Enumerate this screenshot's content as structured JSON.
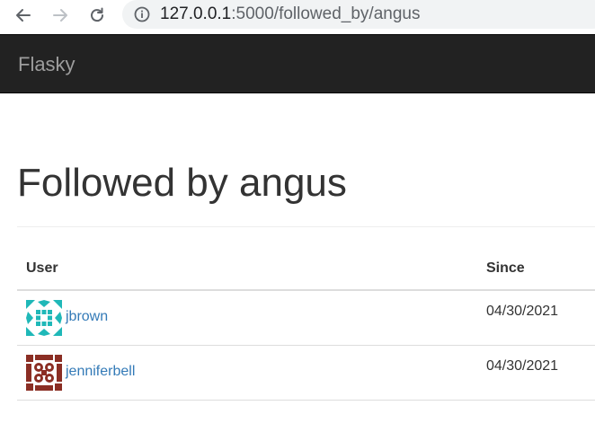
{
  "browser": {
    "url_host": "127.0.0.1",
    "url_path": ":5000/followed_by/angus",
    "back_icon": "arrow-left-icon",
    "forward_icon": "arrow-right-icon",
    "reload_icon": "reload-icon",
    "info_icon": "info-icon"
  },
  "navbar": {
    "brand": "Flasky",
    "background": "#222222",
    "brand_color": "#9d9d9d"
  },
  "page": {
    "title": "Followed by angus"
  },
  "table": {
    "headers": {
      "user": "User",
      "since": "Since"
    },
    "rows": [
      {
        "username": "jbrown",
        "since": "04/30/2021",
        "avatar_color": "#1fb8b8"
      },
      {
        "username": "jenniferbell",
        "since": "04/30/2021",
        "avatar_color": "#8b2e24"
      }
    ]
  },
  "colors": {
    "link": "#337ab7",
    "text": "#333333"
  }
}
